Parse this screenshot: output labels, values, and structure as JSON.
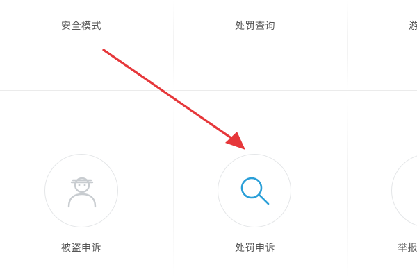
{
  "top_row": {
    "items": [
      {
        "label": "安全模式",
        "icon": "shield-icon"
      },
      {
        "label": "处罚查询",
        "icon": "search-icon"
      },
      {
        "label": "游",
        "icon": "unknown-icon"
      }
    ]
  },
  "bottom_row": {
    "items": [
      {
        "label": "被盗申诉",
        "icon": "masked-person-icon"
      },
      {
        "label": "处罚申诉",
        "icon": "search-icon"
      },
      {
        "label": "举报",
        "icon": "report-icon"
      }
    ]
  },
  "annotation": {
    "type": "arrow",
    "color": "#e6373a",
    "points_to": "处罚申诉"
  },
  "colors": {
    "icon_gray": "#c8ccd0",
    "icon_blue": "#2a9fd8",
    "circle_border": "#e4e6e8",
    "label": "#555555"
  }
}
